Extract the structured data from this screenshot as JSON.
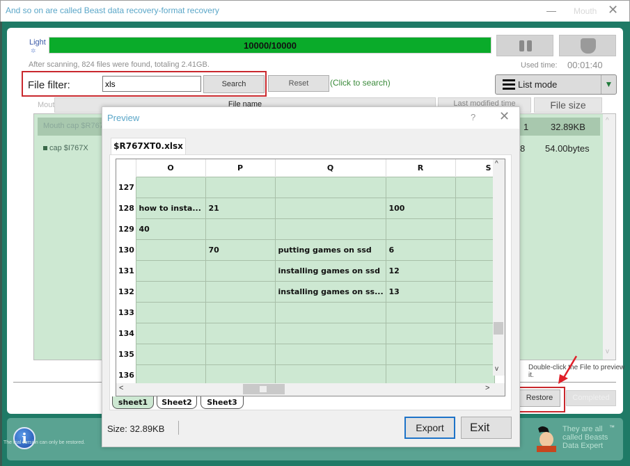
{
  "window": {
    "title": "And so on are called Beast data recovery-format recovery",
    "minimize_glyph": "—",
    "extra_label": "Mouth",
    "close_glyph": "✕"
  },
  "scan": {
    "status_label": "Light",
    "progress_text": "10000/10000",
    "progress_fraction": 1.0,
    "summary": "After scanning, 824 files were found, totaling 2.41GB.",
    "used_time_label": "Used time:",
    "used_time": "00:01:40"
  },
  "filter": {
    "label": "File filter:",
    "value": "xls",
    "search_label": "Search",
    "reset_label": "Reset",
    "hint": "(Click to search)"
  },
  "view_mode": {
    "selected": "List mode",
    "arrow_glyph": "▼"
  },
  "file_table": {
    "columns": [
      "Mouth",
      "File name",
      "Last modified time",
      "File size"
    ],
    "rows": [
      {
        "name": "Mouth cap $R767",
        "modified_fragment": "1",
        "size": "32.89KB",
        "selected": true
      },
      {
        "name": "cap $I767X",
        "modified_fragment": "8",
        "size": "54.00bytes",
        "selected": false
      }
    ],
    "scroll_up": "^",
    "scroll_down": "v"
  },
  "hint_dblclick": "Double-click the File to preview it.",
  "actions": {
    "restore_label": "Restore",
    "completed_label": "Completed"
  },
  "bottom": {
    "note": "The trial version can only be restored.",
    "info_glyph": "i",
    "brand_text": "They are all called Beasts Data Expert",
    "tm": "™"
  },
  "preview": {
    "title": "Preview",
    "help_glyph": "?",
    "close_glyph": "✕",
    "file_tab": "$R767XT0.xlsx",
    "columns": [
      "O",
      "P",
      "Q",
      "R",
      "S"
    ],
    "rows": [
      {
        "num": "127",
        "cells": [
          "",
          "",
          "",
          "",
          ""
        ]
      },
      {
        "num": "128",
        "cells": [
          "how to insta...",
          "21",
          "",
          "100",
          ""
        ]
      },
      {
        "num": "129",
        "cells": [
          "40",
          "",
          "",
          "",
          ""
        ]
      },
      {
        "num": "130",
        "cells": [
          "",
          "70",
          "putting games on ssd",
          "6",
          ""
        ]
      },
      {
        "num": "131",
        "cells": [
          "",
          "",
          "installing games on ssd",
          "12",
          ""
        ]
      },
      {
        "num": "132",
        "cells": [
          "",
          "",
          "installing games on ss...",
          "13",
          ""
        ]
      },
      {
        "num": "133",
        "cells": [
          "",
          "",
          "",
          "",
          ""
        ]
      },
      {
        "num": "134",
        "cells": [
          "",
          "",
          "",
          "",
          ""
        ]
      },
      {
        "num": "135",
        "cells": [
          "",
          "",
          "",
          "",
          ""
        ]
      },
      {
        "num": "136",
        "cells": [
          "",
          "",
          "",
          "",
          ""
        ]
      }
    ],
    "sheets": [
      "sheet1",
      "Sheet2",
      "Sheet3"
    ],
    "active_sheet": "sheet1",
    "size_label": "Size: 32.89KB",
    "export_label": "Export",
    "exit_label": "Exit",
    "scroll": {
      "up": "^",
      "down": "v",
      "left": "<",
      "right": ">"
    }
  }
}
